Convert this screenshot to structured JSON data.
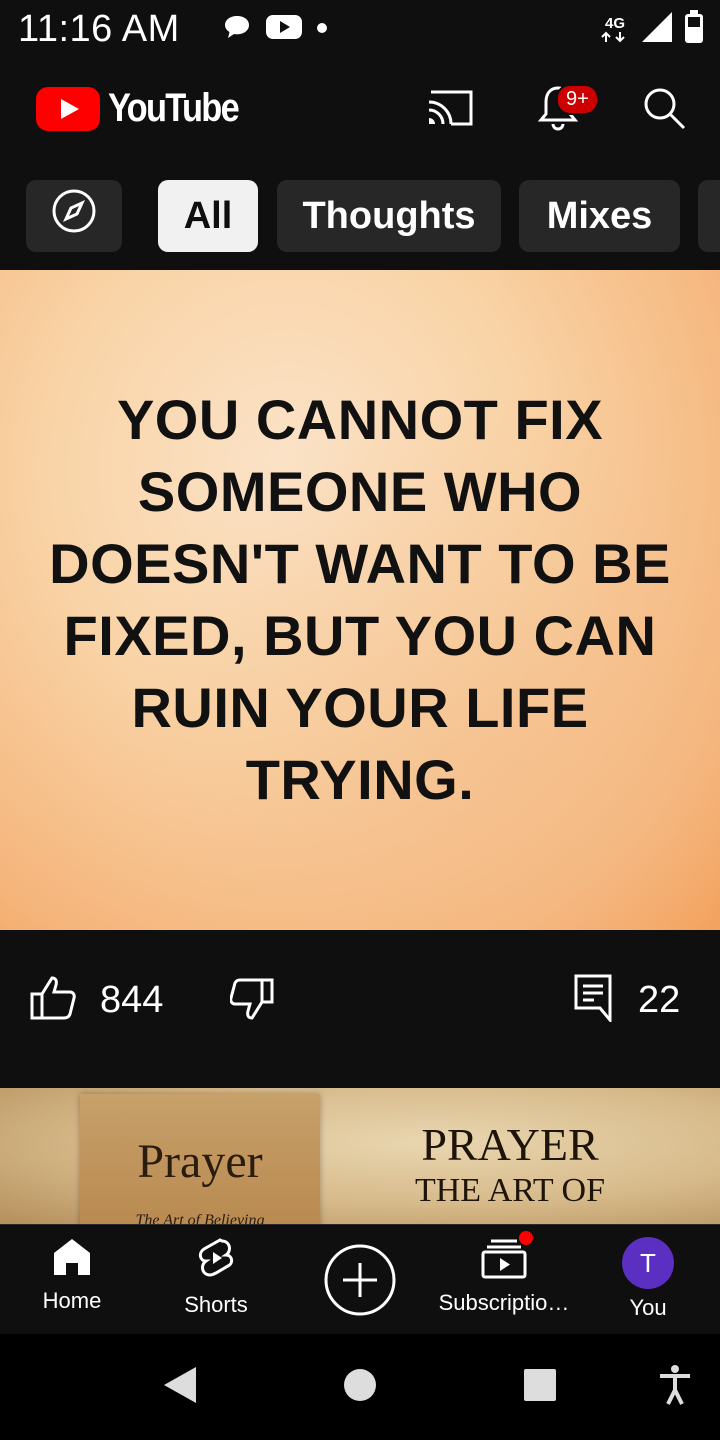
{
  "status_bar": {
    "time": "11:16 AM",
    "network": "4G",
    "icons": [
      "chat-bubble-icon",
      "youtube-status-icon",
      "dot-icon",
      "signal-icon",
      "battery-icon"
    ]
  },
  "header": {
    "logo_text": "YouTube",
    "notification_badge": "9+",
    "icons": [
      "cast-icon",
      "bell-icon",
      "search-icon"
    ]
  },
  "chips": [
    {
      "label": "",
      "icon": "explore-icon"
    },
    {
      "label": "All",
      "active": true
    },
    {
      "label": "Thoughts"
    },
    {
      "label": "Mixes"
    }
  ],
  "post": {
    "quote": "YOU CANNOT FIX SOMEONE WHO DOESN'T WANT TO BE FIXED, BUT YOU CAN RUIN YOUR LIFE TRYING.",
    "likes": "844",
    "comments": "22"
  },
  "next_post": {
    "book_title": "Prayer",
    "book_subtitle": "The Art of Believing",
    "title": "PRAYER",
    "subtitle": "THE ART OF"
  },
  "bottom_nav": {
    "items": [
      {
        "label": "Home",
        "icon": "home-icon"
      },
      {
        "label": "Shorts",
        "icon": "shorts-icon"
      },
      {
        "label": "",
        "icon": "create-icon"
      },
      {
        "label": "Subscriptio…",
        "icon": "subscriptions-icon"
      },
      {
        "label": "You",
        "icon": "avatar"
      }
    ],
    "avatar_letter": "T"
  },
  "colors": {
    "background": "#0f0f0f",
    "brand_red": "#ff0000",
    "avatar": "#5b2fc2",
    "chip_bg": "#272727",
    "chip_active_bg": "#f1f1f1"
  }
}
